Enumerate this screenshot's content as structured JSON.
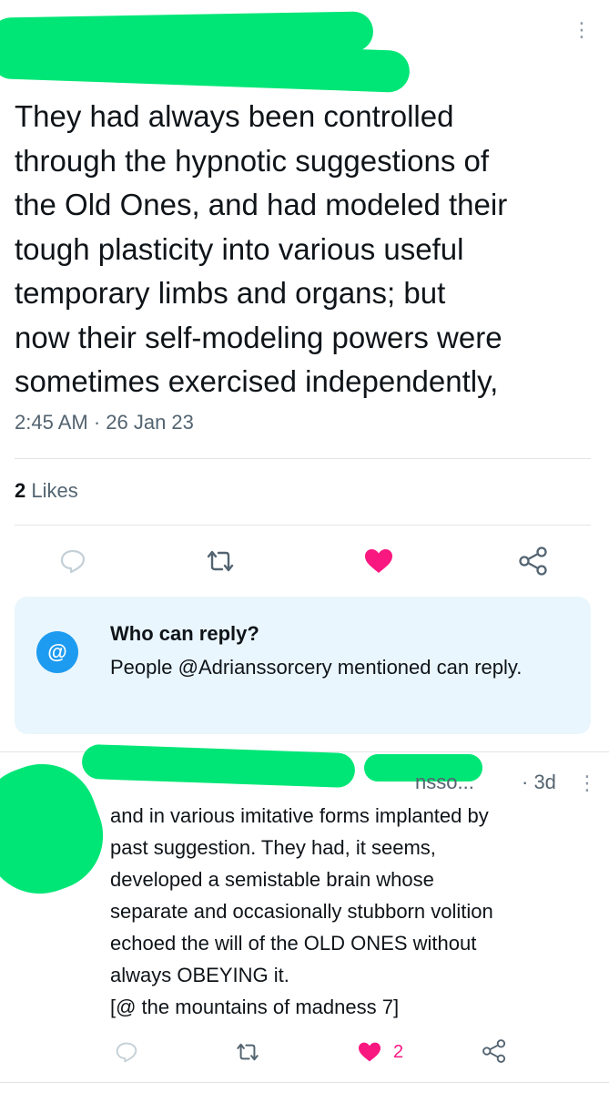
{
  "tweet": {
    "text": "They had always been controlled\nthrough the hypnotic suggestions of\nthe Old Ones, and had modeled their\ntough plasticity into various useful\ntemporary limbs and organs; but\nnow their self-modeling powers were\nsometimes exercised independently,",
    "timestamp": "2:45 AM · 26 Jan 23",
    "likes_count": "2",
    "likes_label": "Likes"
  },
  "actions": {
    "reply_icon": "speech-bubble-icon",
    "retweet_icon": "retweet-icon",
    "like_icon": "heart-icon",
    "share_icon": "share-icon"
  },
  "reply_notice": {
    "badge": "@",
    "title": "Who can reply?",
    "body": "People @Adrianssorcery mentioned can reply."
  },
  "reply": {
    "handle_partial": "nsso...",
    "time": "· 3d",
    "text": "and in various imitative forms implanted by\npast suggestion. They had, it seems,\ndeveloped a semistable brain whose\nseparate and occasionally stubborn volition\nechoed the will of the OLD ONES without\nalways OBEYING it.\n[@ the mountains of madness 7]",
    "like_count": "2"
  },
  "colors": {
    "like_active": "#f91880",
    "accent": "#1d9bf0",
    "muted": "#536471",
    "redaction": "#00e676"
  }
}
